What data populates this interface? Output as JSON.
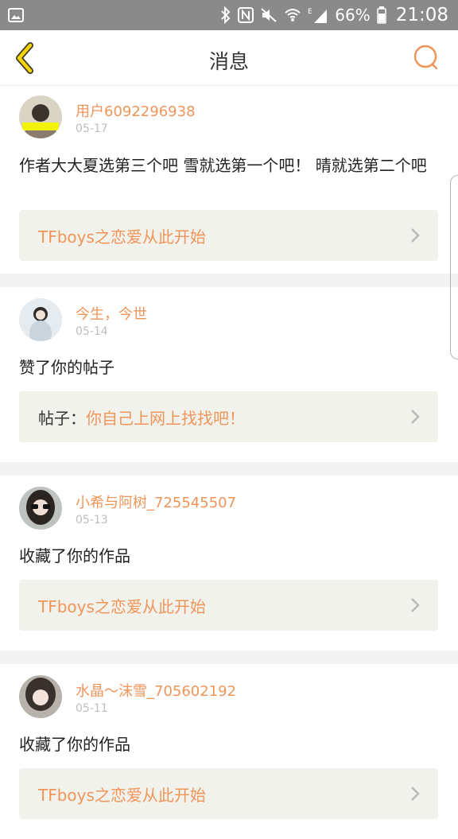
{
  "status_bar": {
    "battery": "66%",
    "time": "21:08",
    "icons": [
      "gallery-icon",
      "bluetooth-icon",
      "nfc-icon",
      "mute-icon",
      "wifi-icon",
      "signal-icon",
      "battery-icon"
    ]
  },
  "header": {
    "title": "消息",
    "back_icon": "chevron-left-icon",
    "search_icon": "search-icon"
  },
  "messages": [
    {
      "username": "用户6092296938",
      "date": "05-17",
      "content": "作者大大夏选第三个吧 雪就选第一个吧！ 晴就选第二个吧",
      "card_prefix": "",
      "card_text": "TFboys之恋爱从此开始"
    },
    {
      "username": "今生，今世",
      "date": "05-14",
      "content": "赞了你的帖子",
      "card_prefix": "帖子：",
      "card_text": "你自己上网上找找吧！"
    },
    {
      "username": "小希与阿树_725545507",
      "date": "05-13",
      "content": "收藏了你的作品",
      "card_prefix": "",
      "card_text": "TFboys之恋爱从此开始"
    },
    {
      "username": "水晶〜沫雪_705602192",
      "date": "05-11",
      "content": "收藏了你的作品",
      "card_prefix": "",
      "card_text": "TFboys之恋爱从此开始"
    }
  ],
  "colors": {
    "accent": "#f0955a",
    "back_icon": "#f5d400",
    "status_bar": "#8a8a8a",
    "card_bg": "#f2f2ec"
  }
}
